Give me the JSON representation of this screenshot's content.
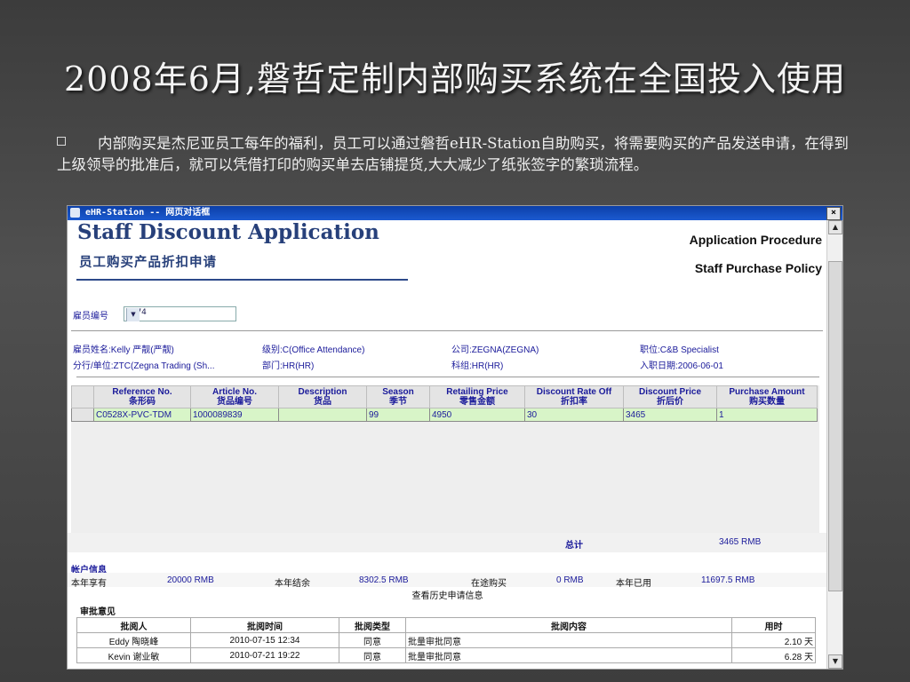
{
  "slide": {
    "title": "2008年6月,磐哲定制内部购买系统在全国投入使用",
    "bullet": "内部购买是杰尼亚员工每年的福利，员工可以通过磐哲eHR-Station自助购买，将需要购买的产品发送申请，在得到上级领导的批准后，就可以凭借打印的购买单去店铺提货,大大减少了纸张签字的繁琐流程。"
  },
  "window": {
    "title": "eHR-Station -- 网页对话框",
    "close": "×"
  },
  "app": {
    "title_en": "Staff Discount Application",
    "title_cn": "员工购买产品折扣申请",
    "link_procedure": "Application Procedure",
    "link_policy": "Staff Purchase Policy",
    "emp_no_label": "雇员编号",
    "emp_no_value": "0574",
    "info": {
      "name": "雇员姓名:Kelly 严靓(严靓)",
      "level": "级别:C(Office Attendance)",
      "company": "公司:ZEGNA(ZEGNA)",
      "position": "职位:C&B Specialist",
      "branch": "分行/单位:ZTC(Zegna Trading (Sh...",
      "dept": "部门:HR(HR)",
      "section": "科组:HR(HR)",
      "hire_date": "入职日期:2006-06-01"
    },
    "columns": [
      {
        "en": "Reference No.",
        "cn": "条形码"
      },
      {
        "en": "Article No.",
        "cn": "货品编号"
      },
      {
        "en": "Description",
        "cn": "货品"
      },
      {
        "en": "Season",
        "cn": "季节"
      },
      {
        "en": "Retailing Price",
        "cn": "零售金额"
      },
      {
        "en": "Discount Rate Off",
        "cn": "折扣率"
      },
      {
        "en": "Discount Price",
        "cn": "折后价"
      },
      {
        "en": "Purchase Amount",
        "cn": "购买数量"
      }
    ],
    "rows": [
      [
        "C0528X-PVC-TDM",
        "1000089839",
        "",
        "99",
        "4950",
        "30",
        "3465",
        "1"
      ]
    ],
    "total_label": "总计",
    "total_value": "3465 RMB",
    "account": {
      "heading": "帐户信息",
      "year_have_label": "本年享有",
      "year_have_value": "20000 RMB",
      "balance_label": "本年结余",
      "balance_value": "8302.5 RMB",
      "pending_label": "在途购买",
      "pending_value": "0 RMB",
      "used_label": "本年已用",
      "used_value": "11697.5 RMB"
    },
    "history_link": "查看历史申请信息",
    "approval_heading": "审批意见",
    "approval_columns": [
      "批阅人",
      "批阅时间",
      "批阅类型",
      "批阅内容",
      "用时"
    ],
    "approvals": [
      [
        "Eddy 陶晓峰",
        "2010-07-15 12:34",
        "同意",
        "批量审批同意",
        "2.10 天"
      ],
      [
        "Kevin 谢业敏",
        "2010-07-21 19:22",
        "同意",
        "批量审批同意",
        "6.28 天"
      ]
    ]
  }
}
